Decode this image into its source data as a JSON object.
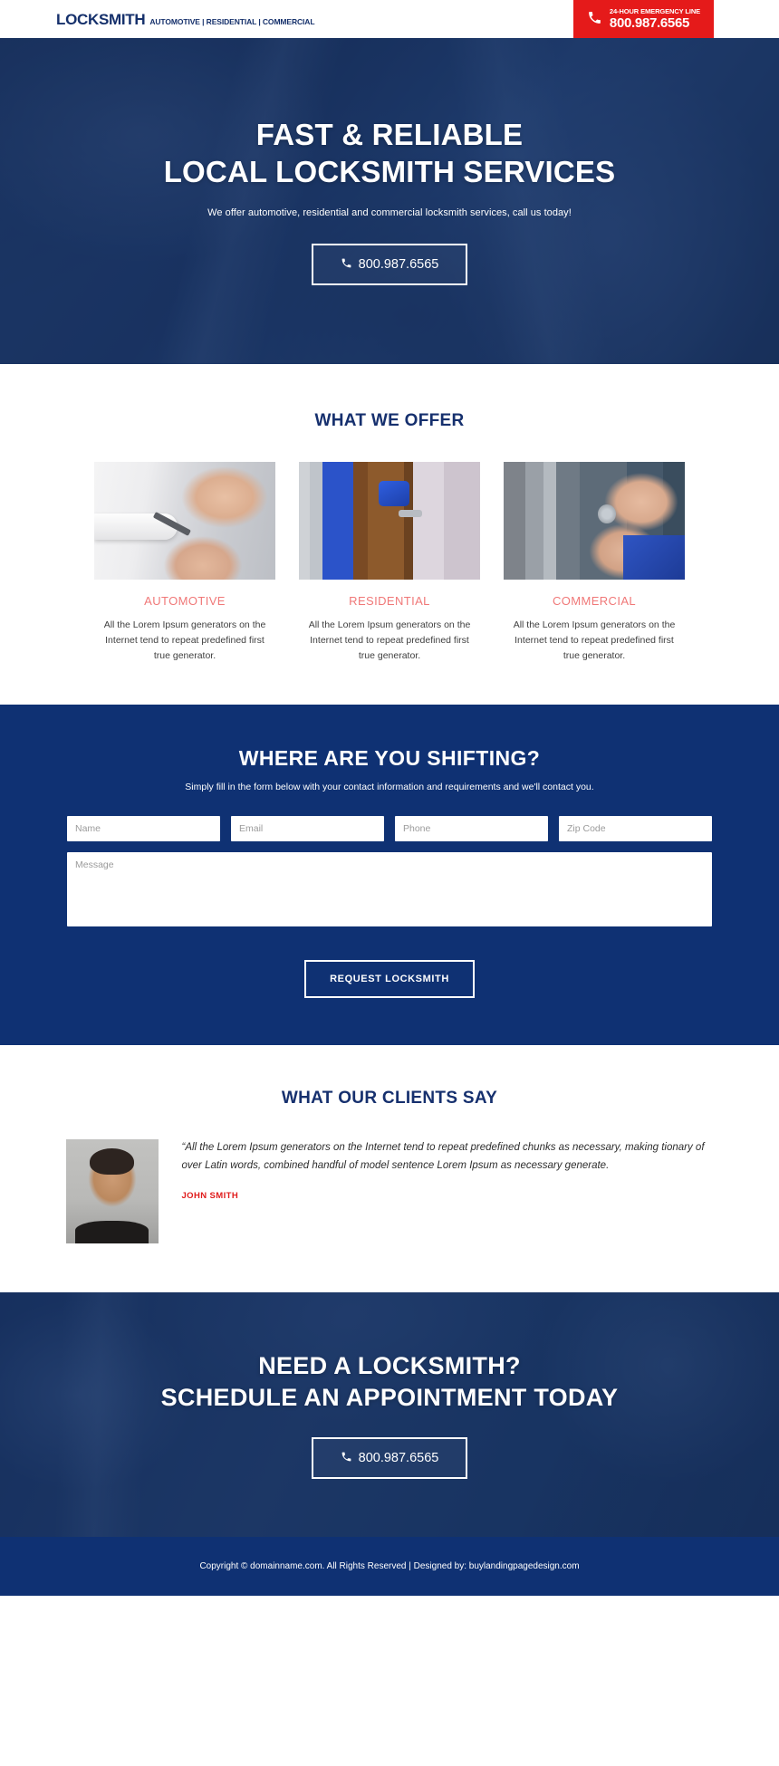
{
  "header": {
    "brand_name": "LOCKSMITH",
    "brand_tagline": "AUTOMOTIVE | RESIDENTIAL | COMMERCIAL",
    "phone_label": "24-HOUR EMERGENCY LINE",
    "phone_number": "800.987.6565",
    "phone_icon": "phone-icon",
    "phone_block_color": "#e51a1a",
    "brand_color": "#15306b"
  },
  "hero": {
    "title_line1": "FAST & RELIABLE",
    "title_line2": "LOCAL LOCKSMITH SERVICES",
    "subtitle": "We offer automotive, residential and commercial locksmith services, call us today!",
    "cta_phone": "800.987.6565",
    "cta_icon": "phone-icon"
  },
  "offer": {
    "title": "WHAT WE OFFER",
    "cards": [
      {
        "label": "AUTOMOTIVE",
        "text": "All the Lorem Ipsum generators on the Internet tend to repeat predefined first true generator.",
        "image_name": "automotive-locksmith-photo"
      },
      {
        "label": "RESIDENTIAL",
        "text": "All the Lorem Ipsum generators on the Internet tend to repeat predefined first true generator.",
        "image_name": "residential-locksmith-photo"
      },
      {
        "label": "COMMERCIAL",
        "text": "All the Lorem Ipsum generators on the Internet tend to repeat predefined first true generator.",
        "image_name": "commercial-locksmith-photo"
      }
    ],
    "label_color": "#f07878",
    "title_color": "#16306e"
  },
  "form": {
    "title": "WHERE ARE YOU SHIFTING?",
    "subtitle": "Simply fill in the form below with your contact information and requirements and we'll contact you.",
    "fields": [
      {
        "name": "name",
        "placeholder": "Name",
        "value": ""
      },
      {
        "name": "email",
        "placeholder": "Email",
        "value": ""
      },
      {
        "name": "phone",
        "placeholder": "Phone",
        "value": ""
      },
      {
        "name": "zip",
        "placeholder": "Zip Code",
        "value": ""
      }
    ],
    "message_placeholder": "Message",
    "message_value": "",
    "submit_label": "REQUEST LOCKSMITH",
    "background_color": "#0f3173"
  },
  "testimonial": {
    "title": "WHAT OUR CLIENTS SAY",
    "quote": "“All the Lorem Ipsum generators on the Internet tend to repeat predefined chunks as necessary, making tionary of over Latin words, combined handful of model sentence Lorem Ipsum as necessary generate.",
    "author": "JOHN SMITH",
    "author_color": "#e01b1b",
    "avatar_name": "client-photo-john-smith"
  },
  "bottom_cta": {
    "title_line1": "NEED A LOCKSMITH?",
    "title_line2": "SCHEDULE AN APPOINTMENT TODAY",
    "cta_phone": "800.987.6565",
    "cta_icon": "phone-icon"
  },
  "footer": {
    "text": "Copyright © domainname.com. All Rights Reserved | Designed by: buylandingpagedesign.com",
    "background_color": "#0f3173"
  }
}
